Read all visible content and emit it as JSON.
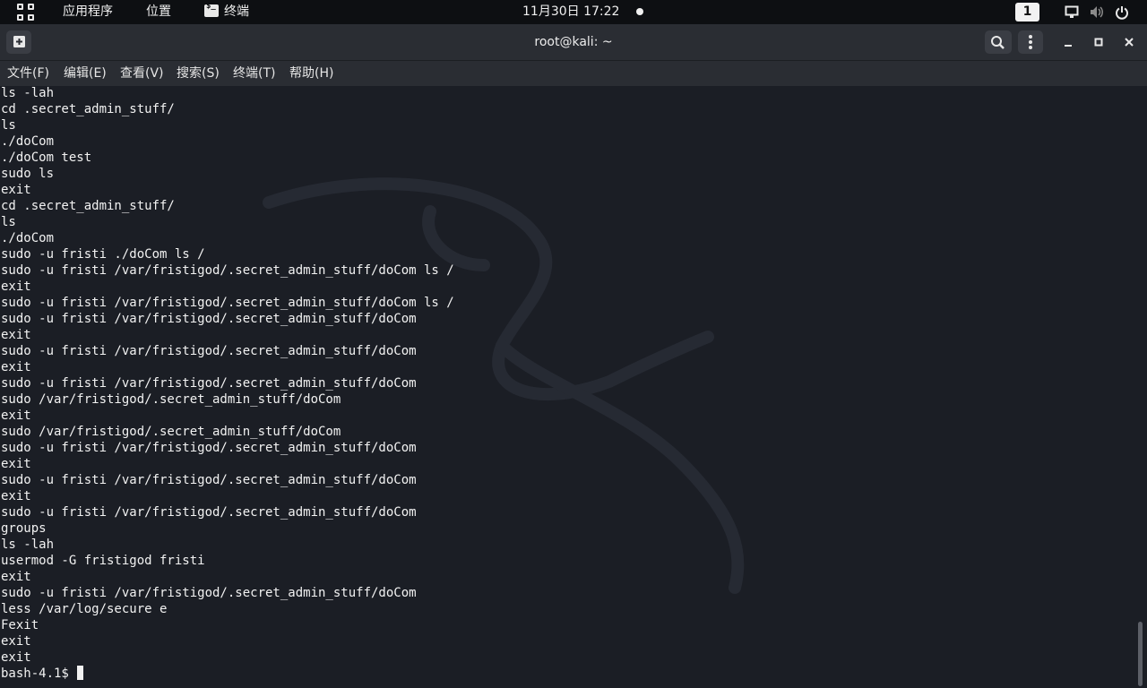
{
  "top_panel": {
    "apps_label": "应用程序",
    "places_label": "位置",
    "active_app_label": "终端",
    "clock": "11月30日 17:22",
    "workspace_number": "1"
  },
  "window": {
    "title": "root@kali: ~"
  },
  "menu": {
    "items": [
      "文件(F)",
      "编辑(E)",
      "查看(V)",
      "搜索(S)",
      "终端(T)",
      "帮助(H)"
    ]
  },
  "terminal": {
    "lines": [
      "ls -lah",
      "cd .secret_admin_stuff/",
      "ls",
      "./doCom",
      "./doCom test",
      "sudo ls",
      "exit",
      "cd .secret_admin_stuff/",
      "ls",
      "./doCom",
      "sudo -u fristi ./doCom ls /",
      "sudo -u fristi /var/fristigod/.secret_admin_stuff/doCom ls /",
      "exit",
      "sudo -u fristi /var/fristigod/.secret_admin_stuff/doCom ls /",
      "sudo -u fristi /var/fristigod/.secret_admin_stuff/doCom",
      "exit",
      "sudo -u fristi /var/fristigod/.secret_admin_stuff/doCom",
      "exit",
      "sudo -u fristi /var/fristigod/.secret_admin_stuff/doCom",
      "sudo /var/fristigod/.secret_admin_stuff/doCom",
      "exit",
      "sudo /var/fristigod/.secret_admin_stuff/doCom",
      "sudo -u fristi /var/fristigod/.secret_admin_stuff/doCom",
      "exit",
      "sudo -u fristi /var/fristigod/.secret_admin_stuff/doCom",
      "exit",
      "sudo -u fristi /var/fristigod/.secret_admin_stuff/doCom",
      "groups",
      "ls -lah",
      "usermod -G fristigod fristi",
      "exit",
      "sudo -u fristi /var/fristigod/.secret_admin_stuff/doCom",
      "less /var/log/secure e",
      "Fexit",
      "exit",
      "exit"
    ],
    "prompt": "bash-4.1$ "
  },
  "icons": {
    "apps": "apps-grid-icon",
    "terminal": "terminal-icon",
    "new_tab": "new-tab-icon",
    "search": "search-icon",
    "menu": "kebab-menu-icon",
    "minimize": "minimize-icon",
    "maximize": "maximize-icon",
    "close": "close-icon",
    "screen": "screen-icon",
    "volume": "volume-icon",
    "power": "power-icon"
  },
  "colors": {
    "panel_bg": "#0d0f12",
    "titlebar_bg": "#2a2d33",
    "terminal_bg": "#1b1e25",
    "terminal_fg": "#f2f2f2"
  }
}
